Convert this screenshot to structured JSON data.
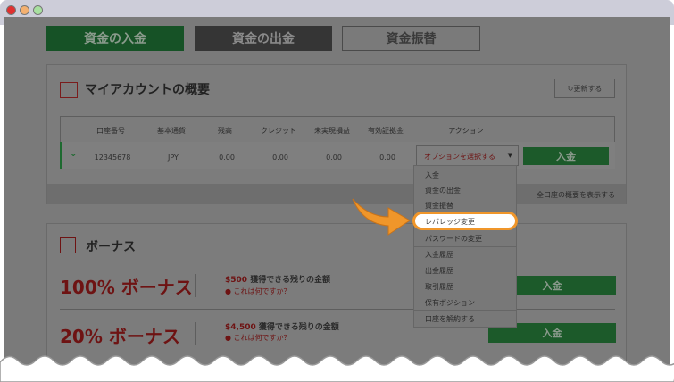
{
  "tabs": {
    "deposit": "資金の入金",
    "withdraw": "資金の出金",
    "transfer": "資金振替"
  },
  "account": {
    "title": "マイアカウントの概要",
    "refresh_label": "更新する",
    "columns": [
      "口座番号",
      "基本通貨",
      "残高",
      "クレジット",
      "未実現損益",
      "有効証拠金",
      "アクション"
    ],
    "row": {
      "number": "12345678",
      "currency": "JPY",
      "balance": "0.00",
      "credit": "0.00",
      "unrealized": "0.00",
      "equity": "0.00"
    },
    "select_placeholder": "オプションを選択する",
    "deposit_label": "入金",
    "view_all": "全口座の概要を表示する"
  },
  "menu": {
    "items": [
      "入金",
      "資金の出金",
      "資金振替",
      "レバレッジ変更",
      "パスワードの変更",
      "入金履歴",
      "出金履歴",
      "取引履歴",
      "保有ポジション",
      "口座を解約する"
    ],
    "highlighted": "レバレッジ変更"
  },
  "bonus": {
    "title": "ボーナス",
    "rows": [
      {
        "name": "100% ボーナス",
        "amount": "$500",
        "text": "獲得できる残りの金額",
        "help": "これは何ですか？",
        "button": "入金"
      },
      {
        "name": "20% ボーナス",
        "amount": "$4,500",
        "text": "獲得できる残りの金額",
        "help": "これは何ですか？",
        "button": "入金"
      }
    ]
  },
  "colors": {
    "accent_green": "#1e7a35",
    "bonus_red": "#a51c1c",
    "highlight_orange": "#f0962a"
  }
}
